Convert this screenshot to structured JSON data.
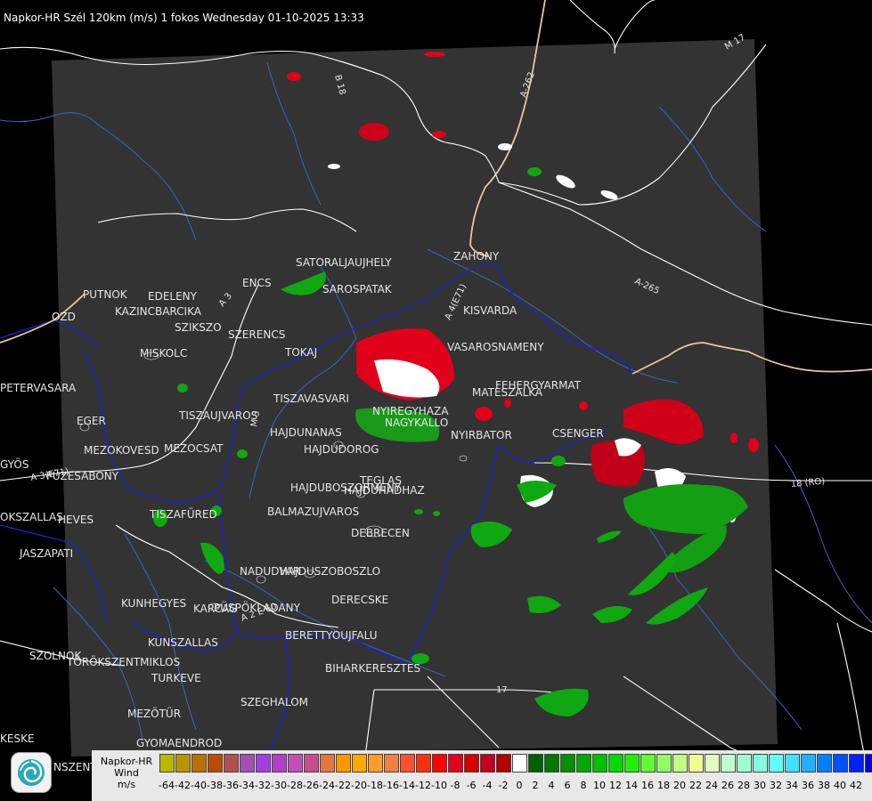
{
  "header": {
    "title": "Napkor-HR Szél 120km (m/s) 1 fokos Wednesday 01-10-2025 13:33"
  },
  "map": {
    "cities": [
      {
        "name": "SATORALJAUJHELY"
      },
      {
        "name": "SAROSPATAK"
      },
      {
        "name": "ZAHONY"
      },
      {
        "name": "KISVARDA"
      },
      {
        "name": "VASAROSNAMENY"
      },
      {
        "name": "FEHERGYARMAT"
      },
      {
        "name": "MATESZALKA"
      },
      {
        "name": "CSENGER"
      },
      {
        "name": "NYIRBATOR"
      },
      {
        "name": "NYIREGYHAZA"
      },
      {
        "name": "NAGYKALLO"
      },
      {
        "name": "TISZAVASVARI"
      },
      {
        "name": "TOKAJ"
      },
      {
        "name": "SZERENCS"
      },
      {
        "name": "SZIKSZO"
      },
      {
        "name": "ENCS"
      },
      {
        "name": "EDELENY"
      },
      {
        "name": "KAZINCBARCIKA"
      },
      {
        "name": "PUTNOK"
      },
      {
        "name": "OZD"
      },
      {
        "name": "MISKOLC"
      },
      {
        "name": "PETERVASARA"
      },
      {
        "name": "EGER"
      },
      {
        "name": "TISZAUJVAROS"
      },
      {
        "name": "HAJDUNANAS"
      },
      {
        "name": "HAJDUDOROG"
      },
      {
        "name": "MEZOKOVESD"
      },
      {
        "name": "MEZOCSAT"
      },
      {
        "name": "GYÖS"
      },
      {
        "name": "FÜZESABONY"
      },
      {
        "name": "HAJDUBOSZORMENY"
      },
      {
        "name": "HAJDUHADHAZ"
      },
      {
        "name": "TEGLAS"
      },
      {
        "name": "BALMAZUJVAROS"
      },
      {
        "name": "TISZAFÜRED"
      },
      {
        "name": "HEVES"
      },
      {
        "name": "OKSZALLAS"
      },
      {
        "name": "JASZAPATI"
      },
      {
        "name": "DEBRECEN"
      },
      {
        "name": "NADUDVAR"
      },
      {
        "name": "HAJDUSZOBOSZLO"
      },
      {
        "name": "KUNHEGYES"
      },
      {
        "name": "KARCAG"
      },
      {
        "name": "PÜSPÖKLADANY"
      },
      {
        "name": "DERECSKE"
      },
      {
        "name": "BERETTYOUJFALU"
      },
      {
        "name": "KUNSZALLAS"
      },
      {
        "name": "SZOLNOK"
      },
      {
        "name": "TÖRÖKSZENTMIKLOS"
      },
      {
        "name": "TURKEVE"
      },
      {
        "name": "BIHARKERESZTES"
      },
      {
        "name": "SZEGHALOM"
      },
      {
        "name": "MEZÖTÜR"
      },
      {
        "name": "KESKE"
      },
      {
        "name": "GYOMAENDROD"
      },
      {
        "name": "NSZENTMARTON"
      }
    ],
    "roads": [
      "B 18",
      "A-262",
      "M 17",
      "A-265",
      "A 3",
      "A 3(E71)",
      "A 4(E71)",
      "M 3",
      "A 2 E 60",
      "18 (RO)",
      "17"
    ]
  },
  "legend": {
    "title_lines": [
      "Napkor-HR",
      "Wind",
      "m/s"
    ],
    "colors": [
      "#b8b800",
      "#b89400",
      "#b87000",
      "#b84c00",
      "#b05050",
      "#a050b0",
      "#a040e0",
      "#b040c8",
      "#c050b8",
      "#c84c8c",
      "#e07840",
      "#ff9800",
      "#ffa800",
      "#ff9c2c",
      "#f08040",
      "#ff5030",
      "#ff3010",
      "#ff0000",
      "#e00020",
      "#d00000",
      "#c00020",
      "#b00000",
      "#ffffff",
      "#006000",
      "#007800",
      "#009000",
      "#00a800",
      "#00c000",
      "#00d800",
      "#20f000",
      "#60ff30",
      "#90ff60",
      "#c0ff80",
      "#f0ff90",
      "#e0ffc0",
      "#c0ffd0",
      "#a0ffd0",
      "#80ffe0",
      "#60ffff",
      "#40e0ff",
      "#20b0ff",
      "#0080ff",
      "#0050ff",
      "#0020ff",
      "#0000e0"
    ],
    "tick_labels": [
      "-64",
      "-42",
      "-40",
      "-38",
      "-36",
      "-34",
      "-32",
      "-30",
      "-28",
      "-26",
      "-24",
      "-22",
      "-20",
      "-18",
      "-16",
      "-14",
      "-12",
      "-10",
      "-8",
      "-6",
      "-4",
      "-2",
      "0",
      "2",
      "4",
      "6",
      "8",
      "10",
      "12",
      "14",
      "16",
      "18",
      "20",
      "22",
      "24",
      "26",
      "28",
      "30",
      "32",
      "34",
      "36",
      "38",
      "40",
      "42"
    ]
  }
}
